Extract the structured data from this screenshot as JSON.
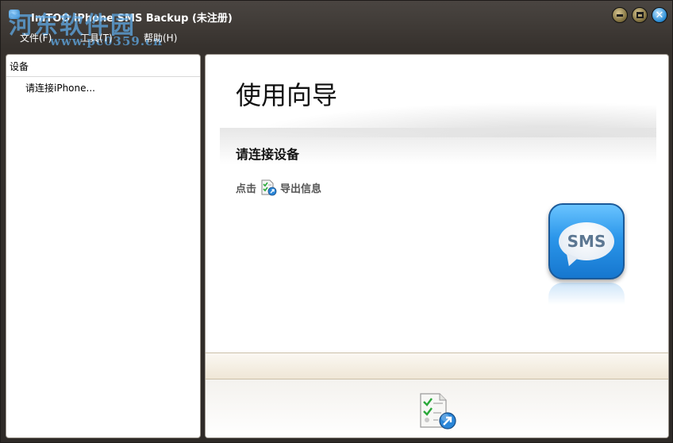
{
  "window": {
    "title": "ImTOO iPhone SMS Backup (未注册)",
    "watermark_text": "河东软件园",
    "watermark_url": "www.pc0359.cn"
  },
  "menu": {
    "file": "文件(F)",
    "tools": "工具(T)",
    "help": "帮助(H)"
  },
  "left_panel": {
    "header": "设备",
    "device_status": "请连接iPhone..."
  },
  "main": {
    "title": "使用向导",
    "heading": "请连接设备",
    "hint_prefix": "点击",
    "hint_suffix": "导出信息",
    "logo_text": "SMS"
  },
  "colors": {
    "accent_blue": "#2b96ea",
    "frame_dark": "#36312d",
    "footer_beige": "#efe6d6"
  },
  "icons": {
    "export": "export-messages-icon",
    "close": "close-icon",
    "minimize": "minimize-icon",
    "maximize": "maximize-icon"
  }
}
